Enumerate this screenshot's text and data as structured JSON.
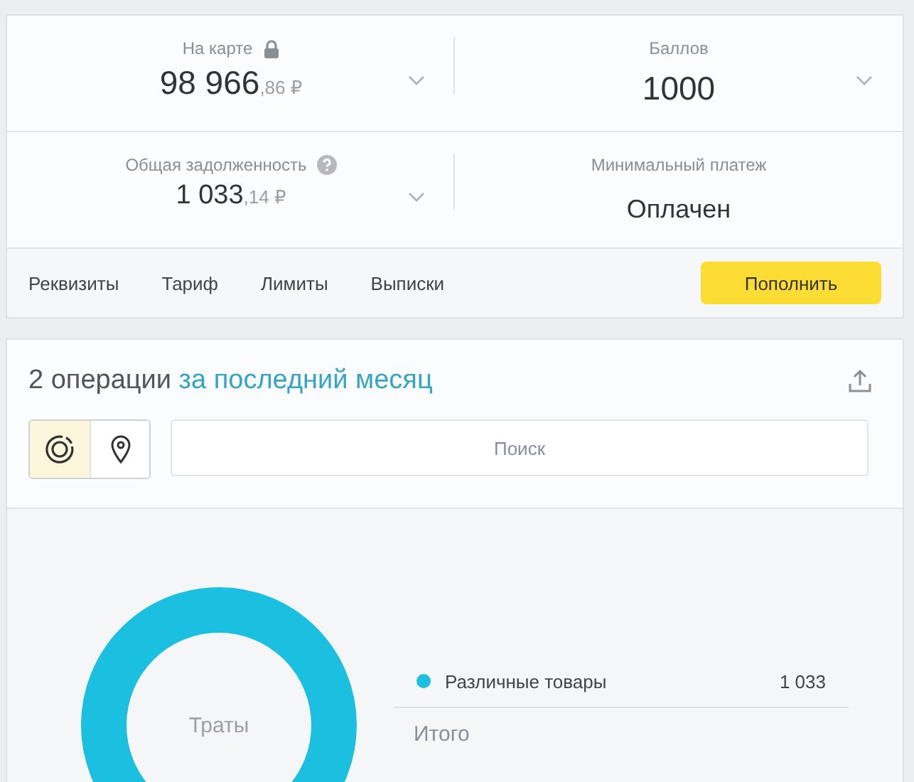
{
  "summary": [
    {
      "kind": "locked",
      "label": "На карте",
      "amount": "98 966",
      "fraction": ",86 ₽",
      "expandable": true
    },
    {
      "kind": "plain",
      "label": "Баллов",
      "amount": "1000",
      "expandable": true
    },
    {
      "kind": "info",
      "label": "Общая задолженность",
      "amount": "1 033",
      "fraction": ",14 ₽",
      "expandable": true
    },
    {
      "kind": "plain",
      "label": "Минимальный платеж",
      "status": "Оплачен",
      "expandable": false
    }
  ],
  "nav": [
    "Реквизиты",
    "Тариф",
    "Лимиты",
    "Выписки"
  ],
  "topup_button": "Пополнить",
  "operations": {
    "count_text": "2 операции",
    "period_link": "за последний месяц",
    "view_toggles": [
      {
        "kind": "chart",
        "selected": true
      },
      {
        "kind": "map",
        "selected": false
      }
    ],
    "search": {
      "placeholder": "Поиск"
    },
    "donut_label": "Траты",
    "legend": [
      {
        "name": "Различные товары",
        "value": "1 033",
        "color": "#1bbfe0"
      }
    ],
    "total_label": "Итого"
  }
}
